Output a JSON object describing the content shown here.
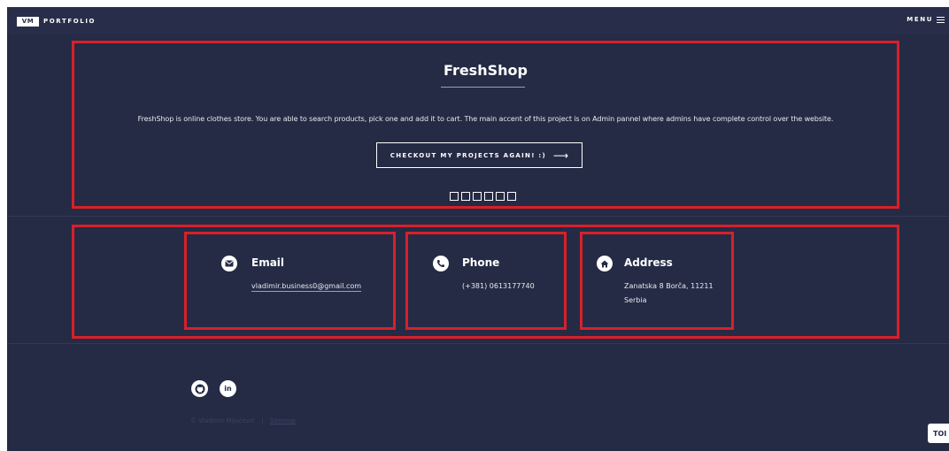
{
  "header": {
    "logo": "VM",
    "brand": "PORTFOLIO",
    "menu_label": "MENU",
    "menu_icon": "hamburger-icon"
  },
  "project": {
    "title": "FreshShop",
    "description": "FreshShop is online clothes store. You are able to search products, pick one and add it to cart. The main accent of this project is on Admin pannel where admins have complete control over the website.",
    "button_label": "CHECKOUT MY PROJECTS AGAIN! :)",
    "button_arrow": "⟶",
    "dots_count": 6
  },
  "contact": {
    "email": {
      "icon": "envelope-icon",
      "title": "Email",
      "value": "vladimir.business0@gmail.com"
    },
    "phone": {
      "icon": "phone-icon",
      "title": "Phone",
      "value": "(+381) 0613177740"
    },
    "address": {
      "icon": "home-icon",
      "title": "Address",
      "line1": "Zanatska 8 Borča, 11211",
      "line2": "Serbia"
    }
  },
  "footer": {
    "social": [
      {
        "icon": "github-icon",
        "label": "GitHub"
      },
      {
        "icon": "linkedin-icon",
        "label": "in"
      }
    ],
    "copyright": "© Vladimir Mijučević",
    "separator": "|",
    "sitemap": "Sitemap",
    "top_label": "TOI"
  },
  "colors": {
    "background": "#252b45",
    "highlight_border": "#d8202a",
    "text": "#ffffff"
  }
}
